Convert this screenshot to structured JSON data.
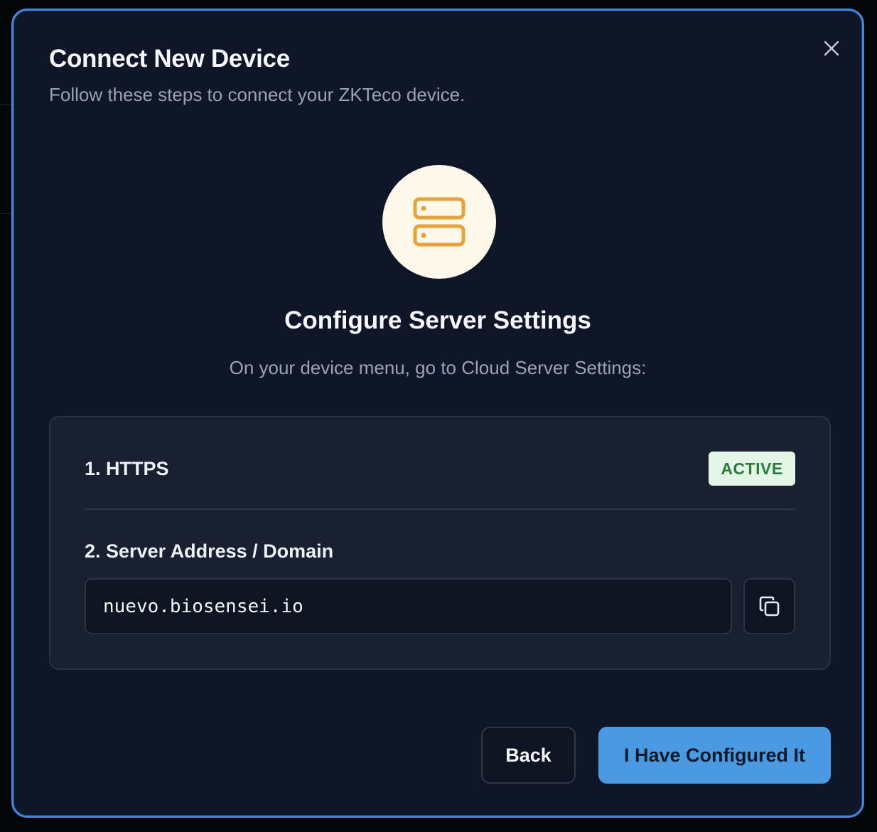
{
  "dialog": {
    "title": "Connect New Device",
    "subtitle": "Follow these steps to connect your ZKTeco device."
  },
  "step": {
    "icon": "server-icon",
    "title": "Configure Server Settings",
    "description": "On your device menu, go to Cloud Server Settings:"
  },
  "settings": {
    "https_label": "1. HTTPS",
    "https_status": "ACTIVE",
    "server_label": "2. Server Address / Domain",
    "server_value": "nuevo.biosensei.io"
  },
  "actions": {
    "back_label": "Back",
    "confirm_label": "I Have Configured It"
  },
  "colors": {
    "accent": "#4a9ae2",
    "modal_border": "#4a86d8",
    "icon_orange": "#e8a23a",
    "success": "#2a7a3b"
  }
}
